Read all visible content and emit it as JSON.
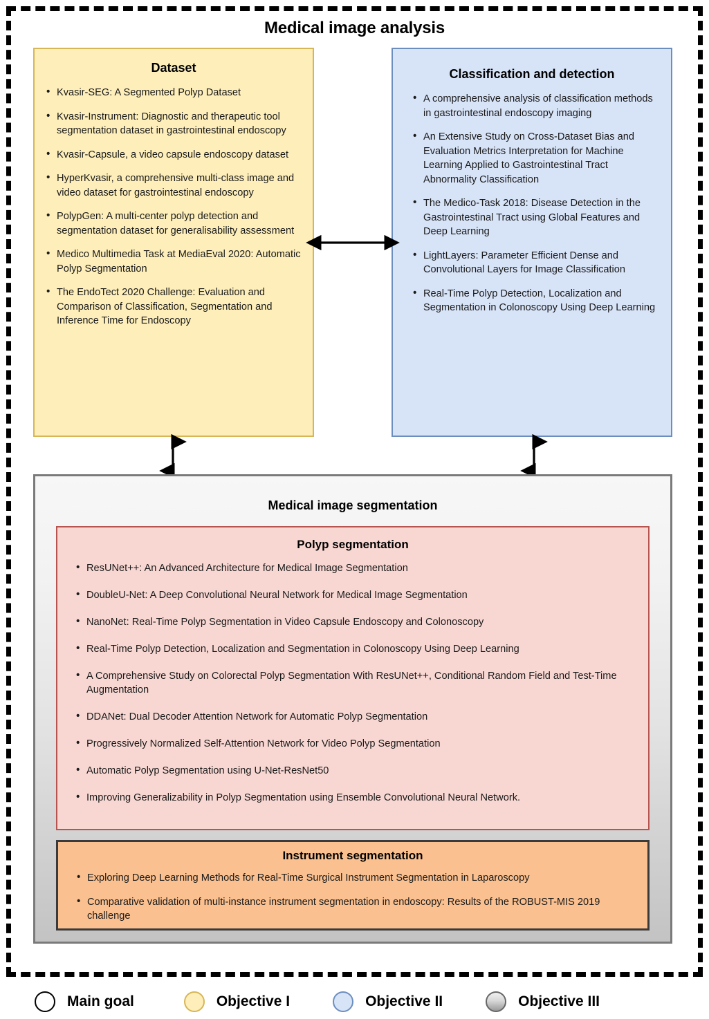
{
  "title": "Medical image analysis",
  "dataset": {
    "title": "Dataset",
    "items": [
      "Kvasir-SEG: A Segmented Polyp Dataset",
      "Kvasir-Instrument: Diagnostic and therapeutic tool segmentation dataset in gastrointestinal endoscopy",
      "Kvasir-Capsule, a video capsule endoscopy dataset",
      "HyperKvasir, a comprehensive multi-class image and video dataset for gastrointestinal endoscopy",
      "PolypGen: A multi-center polyp detection and segmentation dataset for generalisability assessment",
      "Medico Multimedia Task at MediaEval 2020: Automatic Polyp Segmentation",
      "The EndoTect 2020 Challenge: Evaluation and Comparison of Classification, Segmentation and Inference Time for Endoscopy"
    ]
  },
  "classification": {
    "title": "Classification and detection",
    "items": [
      "A comprehensive analysis of classification methods in gastrointestinal endoscopy imaging",
      "An Extensive Study on Cross-Dataset Bias and Evaluation Metrics Interpretation for Machine Learning Applied to Gastrointestinal Tract Abnormality Classification",
      "The Medico-Task 2018: Disease Detection in the Gastrointestinal Tract using Global Features and Deep Learning",
      "LightLayers: Parameter Efficient Dense and Convolutional Layers for Image Classification",
      "Real-Time Polyp Detection, Localization and Segmentation in Colonoscopy Using Deep Learning"
    ]
  },
  "segmentation": {
    "title": "Medical image segmentation",
    "polyp": {
      "title": "Polyp segmentation",
      "items": [
        "ResUNet++: An Advanced Architecture for Medical Image Segmentation",
        "DoubleU-Net: A Deep Convolutional Neural Network for Medical Image Segmentation",
        "NanoNet: Real-Time Polyp Segmentation in Video Capsule Endoscopy and Colonoscopy",
        "Real-Time Polyp Detection, Localization and Segmentation in Colonoscopy Using Deep Learning",
        "A Comprehensive Study on Colorectal Polyp Segmentation With ResUNet++, Conditional Random Field and Test-Time Augmentation",
        "DDANet: Dual Decoder Attention Network for Automatic Polyp Segmentation",
        "Progressively Normalized Self-Attention Network for Video Polyp Segmentation",
        "Automatic Polyp Segmentation using U-Net-ResNet50",
        "Improving Generalizability in Polyp Segmentation using Ensemble Convolutional Neural Network."
      ]
    },
    "instrument": {
      "title": "Instrument segmentation",
      "items": [
        "Exploring Deep Learning Methods for Real-Time Surgical Instrument Segmentation in Laparoscopy",
        "Comparative validation of multi-instance instrument segmentation in endoscopy: Results of the ROBUST-MIS 2019 challenge"
      ]
    }
  },
  "legend": {
    "items": [
      {
        "label": "Main goal",
        "color": "#ffffff",
        "border": "#000000"
      },
      {
        "label": "Objective I",
        "color": "#fdeeba",
        "border": "#d6b656"
      },
      {
        "label": "Objective II",
        "color": "#d7e3f7",
        "border": "#6c8ebf"
      },
      {
        "label": "Objective III",
        "color": "#d8d8d8",
        "border": "#666666"
      }
    ]
  }
}
